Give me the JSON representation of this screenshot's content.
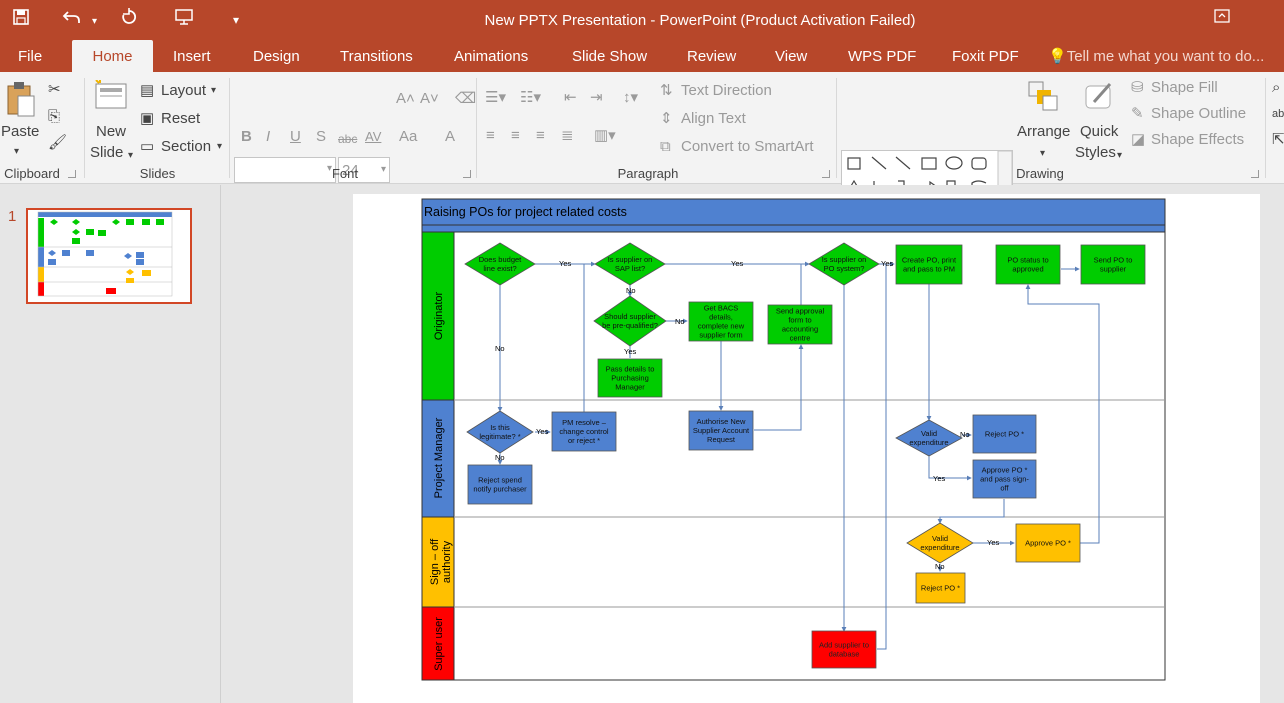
{
  "window": {
    "title": "New PPTX Presentation - PowerPoint (Product Activation Failed)"
  },
  "tabs": [
    "File",
    "Home",
    "Insert",
    "Design",
    "Transitions",
    "Animations",
    "Slide Show",
    "Review",
    "View",
    "WPS PDF",
    "Foxit PDF"
  ],
  "tell_me": "Tell me what you want to do...",
  "ribbon": {
    "paste": "Paste",
    "new_slide_1": "New",
    "new_slide_2": "Slide",
    "layout": "Layout",
    "reset": "Reset",
    "section": "Section",
    "font_size": "24",
    "text_direction": "Text Direction",
    "align_text": "Align Text",
    "convert_smartart": "Convert to SmartArt",
    "arrange": "Arrange",
    "quick_1": "Quick",
    "quick_2": "Styles",
    "shape_fill": "Shape Fill",
    "shape_outline": "Shape Outline",
    "shape_effects": "Shape Effects",
    "bold": "B",
    "italic": "I",
    "underline": "U",
    "strike": "S",
    "abc": "abc",
    "av": "AV",
    "aa": "Aa",
    "a": "A",
    "groups": {
      "clipboard": "Clipboard",
      "slides": "Slides",
      "font": "Font",
      "paragraph": "Paragraph",
      "drawing": "Drawing"
    }
  },
  "thumbnail": {
    "number": "1"
  },
  "colors": {
    "accent": "#b7472a",
    "green": "#00cc00",
    "blue": "#4f81d0",
    "orange": "#ffc000",
    "red": "#ff0000"
  },
  "diagram": {
    "title": "Raising POs for project related costs",
    "lanes": [
      "Originator",
      "Project Manager",
      "Sign – off authority",
      "Super user"
    ],
    "nodes": {
      "d_budget": [
        "Does budget",
        "line exist?"
      ],
      "d_sap": [
        "Is supplier on",
        "SAP list?"
      ],
      "d_po": [
        "Is supplier on",
        "PO system?"
      ],
      "create_po": [
        "Create PO, print",
        "and pass to PM"
      ],
      "po_status": [
        "PO status to",
        "approved"
      ],
      "send_po": [
        "Send PO to",
        "supplier"
      ],
      "d_prequal": [
        "Should supplier",
        "be pre-qualified?"
      ],
      "bacs": [
        "Get BACS",
        "details,",
        "complete new",
        "supplier form"
      ],
      "send_approval": [
        "Send approval",
        "form to",
        "accounting",
        "centre"
      ],
      "pass_details": [
        "Pass details to",
        "Purchasing",
        "Manager"
      ],
      "d_legit": [
        "Is this",
        "legitimate? *"
      ],
      "pm_resolve": [
        "PM resolve –",
        "change control",
        "or reject *"
      ],
      "authorise": [
        "Authorise New",
        "Supplier Account",
        "Request"
      ],
      "d_valid_pm": [
        "Valid",
        "expenditure"
      ],
      "reject_po_pm": [
        "Reject PO *"
      ],
      "approve_pm": [
        "Approve PO *",
        "and pass sign-",
        "off"
      ],
      "reject_spend": [
        "Reject spend",
        "notify purchaser"
      ],
      "d_valid_so": [
        "Valid",
        "expenditure"
      ],
      "approve_so": [
        "Approve PO *"
      ],
      "reject_po_so": [
        "Reject PO *"
      ],
      "add_supplier": [
        "Add supplier to",
        "database"
      ]
    },
    "labels": {
      "yes": "Yes",
      "no": "No"
    }
  }
}
